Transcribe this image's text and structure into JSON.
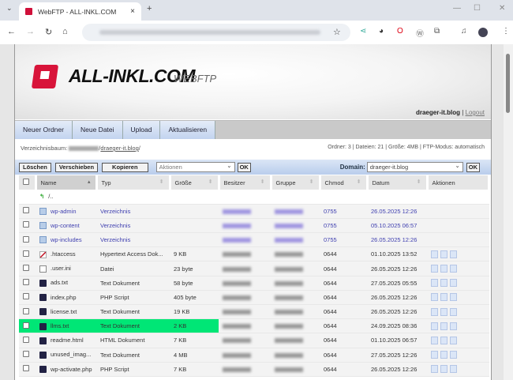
{
  "browser": {
    "tab_title": "WebFTP - ALL-INKL.COM",
    "new_tab": "+",
    "close": "×"
  },
  "header": {
    "logo": "ALL-INKL.COM",
    "logo_sub": "WEBFTP",
    "user": "draeger-it.blog",
    "separator": "|",
    "logout": "Logout"
  },
  "menu": [
    "Neuer Ordner",
    "Neue Datei",
    "Upload",
    "Aktualisieren"
  ],
  "path": {
    "label": "Verzeichnisbaum:",
    "dir": "draeger-it.blog",
    "trail": "/"
  },
  "stats": "Ordner: 3 | Dateien: 21 | Größe: 4MB | FTP-Modus: automatisch",
  "actions": {
    "delete": "Löschen",
    "move": "Verschieben",
    "copy": "Kopieren",
    "select": "Aktionen",
    "ok": "OK",
    "domain_label": "Domain:",
    "domain": "draeger-it.blog"
  },
  "columns": [
    "Name",
    "Typ",
    "Größe",
    "Besitzer",
    "Gruppe",
    "Chmod",
    "Datum",
    "Aktionen"
  ],
  "parent": "/..",
  "rows": [
    {
      "name": "wp-admin",
      "type": "Verzeichnis",
      "size": "",
      "chmod": "0755",
      "date": "26.05.2025 12:26",
      "icon": "folder",
      "dir": true
    },
    {
      "name": "wp-content",
      "type": "Verzeichnis",
      "size": "",
      "chmod": "0755",
      "date": "05.10.2025 06:57",
      "icon": "folder",
      "dir": true
    },
    {
      "name": "wp-includes",
      "type": "Verzeichnis",
      "size": "",
      "chmod": "0755",
      "date": "26.05.2025 12:26",
      "icon": "folder",
      "dir": true
    },
    {
      "name": ".htaccess",
      "type": "Hypertext Access Dok...",
      "size": "9 KB",
      "chmod": "0644",
      "date": "01.10.2025 13:52",
      "icon": "ht"
    },
    {
      "name": ".user.ini",
      "type": "Datei",
      "size": "23 byte",
      "chmod": "0644",
      "date": "26.05.2025 12:26",
      "icon": "file"
    },
    {
      "name": "ads.txt",
      "type": "Text Dokument",
      "size": "58 byte",
      "chmod": "0644",
      "date": "27.05.2025 05:55",
      "icon": "txt"
    },
    {
      "name": "index.php",
      "type": "PHP Script",
      "size": "405 byte",
      "chmod": "0644",
      "date": "26.05.2025 12:26",
      "icon": "txt"
    },
    {
      "name": "license.txt",
      "type": "Text Dokument",
      "size": "19 KB",
      "chmod": "0644",
      "date": "26.05.2025 12:26",
      "icon": "txt"
    },
    {
      "name": "llms.txt",
      "type": "Text Dokument",
      "size": "2 KB",
      "chmod": "0644",
      "date": "24.09.2025 08:36",
      "icon": "txt",
      "highlight": "#00e676"
    },
    {
      "name": "readme.html",
      "type": "HTML Dokument",
      "size": "7 KB",
      "chmod": "0644",
      "date": "01.10.2025 06:57",
      "icon": "txt"
    },
    {
      "name": "unused_imag...",
      "type": "Text Dokument",
      "size": "4 MB",
      "chmod": "0644",
      "date": "27.05.2025 12:26",
      "icon": "txt"
    },
    {
      "name": "wp-activate.php",
      "type": "PHP Script",
      "size": "7 KB",
      "chmod": "0644",
      "date": "26.05.2025 12:26",
      "icon": "txt"
    }
  ]
}
